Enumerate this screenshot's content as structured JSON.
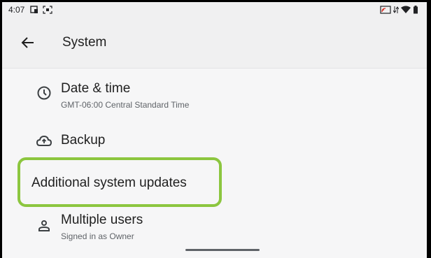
{
  "status_bar": {
    "time": "4:07",
    "left_icons": [
      "cast-icon",
      "screenshot-icon"
    ],
    "right_icons": [
      "cast-screen-icon",
      "data-icon",
      "wifi-icon",
      "battery-icon"
    ]
  },
  "header": {
    "back_icon": "arrow-back-icon",
    "title": "System"
  },
  "settings": [
    {
      "icon": "clock-icon",
      "title": "Date & time",
      "subtitle": "GMT-06:00 Central Standard Time"
    },
    {
      "icon": "cloud-upload-icon",
      "title": "Backup"
    },
    {
      "title": "Additional system updates",
      "highlighted": true,
      "highlight_color": "#8cc63f"
    },
    {
      "icon": "person-icon",
      "title": "Multiple users",
      "subtitle": "Signed in as Owner"
    }
  ],
  "colors": {
    "background": "#f6f6f7",
    "highlight": "#8cc63f",
    "primary_text": "#1f1f1f",
    "secondary_text": "#5f6368"
  }
}
